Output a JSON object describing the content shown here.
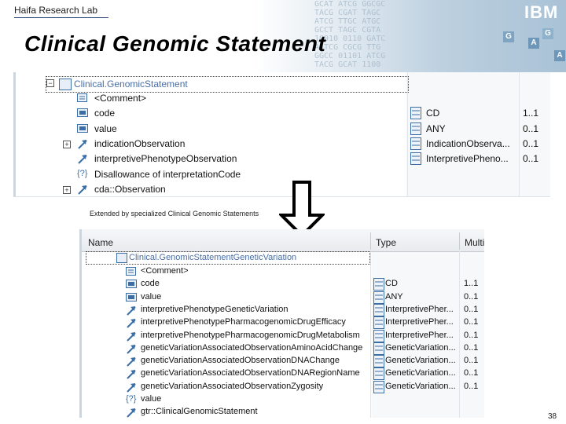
{
  "header": {
    "lab": "Haifa Research Lab",
    "title": "Clinical Genomic Statement",
    "logo": "IBM",
    "dna_text": "GCAT ATCG GGCGC\nTACG CGAT TAGC\nATCG TTGC ATGC\nGCCT TAGC CGTA\n10010 0110 GATC\nAATCG CGCG TTG\nGGCC 01101 ATCG\nTACG GCAT 1100"
  },
  "top_panel": {
    "root": "Clinical.GenomicStatement",
    "rows": [
      {
        "name": "<Comment>",
        "type": "",
        "mult": ""
      },
      {
        "name": "code",
        "type": "CD",
        "mult": "1..1"
      },
      {
        "name": "value",
        "type": "ANY",
        "mult": "0..1"
      },
      {
        "name": "indicationObservation",
        "type": "IndicationObserva...",
        "mult": "0..1"
      },
      {
        "name": "interpretivePhenotypeObservation",
        "type": "InterpretivePheno...",
        "mult": "0..1"
      },
      {
        "name": "Disallowance of interpretationCode",
        "type": "",
        "mult": ""
      },
      {
        "name": "cda::Observation",
        "type": "",
        "mult": ""
      }
    ]
  },
  "caption": "Extended by specialized Clinical Genomic Statements",
  "bottom_panel": {
    "col_name": "Name",
    "col_type": "Type",
    "col_mult": "Multi",
    "root": "Clinical.GenomicStatementGeneticVariation",
    "rows": [
      {
        "name": "<Comment>",
        "type": "",
        "mult": ""
      },
      {
        "name": "code",
        "type": "CD",
        "mult": "1..1"
      },
      {
        "name": "value",
        "type": "ANY",
        "mult": "0..1"
      },
      {
        "name": "interpretivePhenotypeGeneticVariation",
        "type": "InterpretivePher...",
        "mult": "0..1"
      },
      {
        "name": "interpretivePhenotypePharmacogenomicDrugEfficacy",
        "type": "InterpretivePher...",
        "mult": "0..1"
      },
      {
        "name": "interpretivePhenotypePharmacogenomicDrugMetabolism",
        "type": "InterpretivePher...",
        "mult": "0..1"
      },
      {
        "name": "geneticVariationAssociatedObservationAminoAcidChange",
        "type": "GeneticVariation...",
        "mult": "0..1"
      },
      {
        "name": "geneticVariationAssociatedObservationDNAChange",
        "type": "GeneticVariation...",
        "mult": "0..1"
      },
      {
        "name": "geneticVariationAssociatedObservationDNARegionName",
        "type": "GeneticVariation...",
        "mult": "0..1"
      },
      {
        "name": "geneticVariationAssociatedObservationZygosity",
        "type": "GeneticVariation...",
        "mult": "0..1"
      },
      {
        "name": "value",
        "type": "",
        "mult": ""
      },
      {
        "name": "gtr::ClinicalGenomicStatement",
        "type": "",
        "mult": ""
      }
    ]
  },
  "page_number": "38",
  "colors": {
    "accent": "#3a6ea5",
    "root_text": "#4a6fa5"
  }
}
